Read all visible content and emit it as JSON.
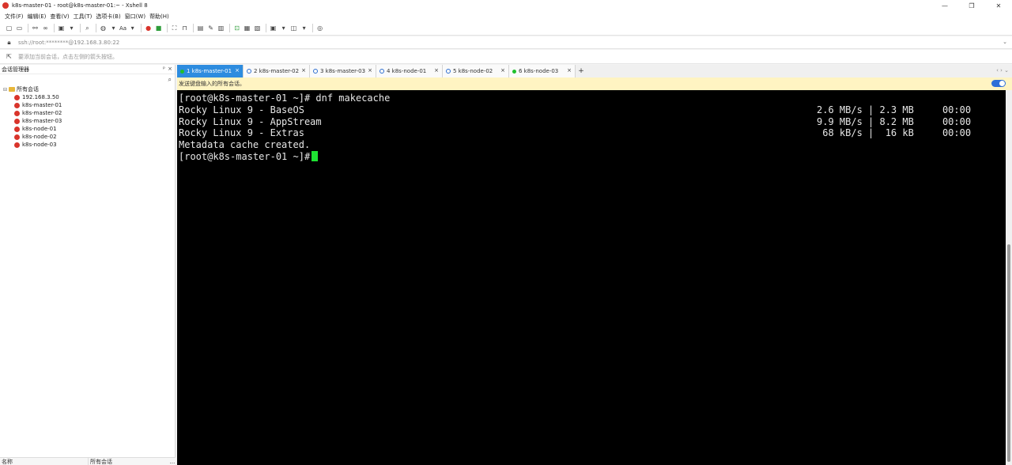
{
  "window": {
    "title": "k8s-master-01 - root@k8s-master-01:~ - Xshell 8",
    "controls": {
      "minimize": "—",
      "restore": "❐",
      "close": "✕"
    }
  },
  "menu": [
    "文件(F)",
    "编辑(E)",
    "查看(V)",
    "工具(T)",
    "选项卡(B)",
    "窗口(W)",
    "帮助(H)"
  ],
  "toolbar": {
    "font_label": "Aa"
  },
  "address": {
    "value": "ssh://root:********@192.168.3.80:22"
  },
  "hint": {
    "text": "要添加当前会话，点击左侧的箭头按钮。"
  },
  "session_panel": {
    "title": "会话管理器",
    "pin": "ᵖ",
    "close": "×",
    "root": "所有会话",
    "sessions": [
      "192.168.3.50",
      "k8s-master-01",
      "k8s-master-02",
      "k8s-master-03",
      "k8s-node-01",
      "k8s-node-02",
      "k8s-node-03"
    ],
    "footer": {
      "col1": "名称",
      "col2": "所有会话",
      "more": "..."
    }
  },
  "tabs": [
    {
      "label": "1 k8s-master-01",
      "status": "connected",
      "active": true
    },
    {
      "label": "2 k8s-master-02",
      "status": "info",
      "active": false
    },
    {
      "label": "3 k8s-master-03",
      "status": "info",
      "active": false
    },
    {
      "label": "4 k8s-node-01",
      "status": "info",
      "active": false
    },
    {
      "label": "5 k8s-node-02",
      "status": "info",
      "active": false
    },
    {
      "label": "6 k8s-node-03",
      "status": "connected",
      "active": false
    }
  ],
  "tab_add": "+",
  "tab_nav": "‹ › ⌄",
  "compose": {
    "text": "发送键盘输入的所有会话。",
    "enabled": true
  },
  "terminal": {
    "prompt": "[root@k8s-master-01 ~]#",
    "command": "dnf makecache",
    "repos": [
      {
        "name": "Rocky Linux 9 - BaseOS",
        "stats": "2.6 MB/s | 2.3 MB     00:00"
      },
      {
        "name": "Rocky Linux 9 - AppStream",
        "stats": "9.9 MB/s | 8.2 MB     00:00"
      },
      {
        "name": "Rocky Linux 9 - Extras",
        "stats": " 68 kB/s |  16 kB     00:00"
      }
    ],
    "message": "Metadata cache created.",
    "colors": {
      "background": "#000000",
      "text": "#e6e6e6",
      "cursor": "#1ee332"
    }
  }
}
